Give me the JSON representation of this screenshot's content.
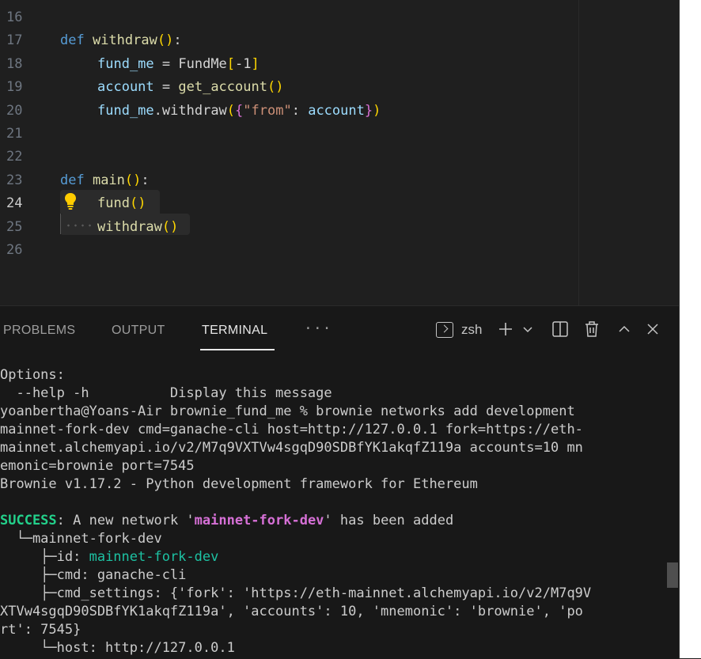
{
  "editor": {
    "lines": [
      {
        "n": "16",
        "tokens": []
      },
      {
        "n": "17",
        "tokens": [
          [
            "kw",
            "def "
          ],
          [
            "fn",
            "withdraw"
          ],
          [
            "pn1",
            "()"
          ],
          [
            "plain",
            ":"
          ]
        ]
      },
      {
        "n": "18",
        "indent": 1,
        "tokens": [
          [
            "var",
            "fund_me"
          ],
          [
            "plain",
            " = "
          ],
          [
            "plain",
            "FundMe"
          ],
          [
            "pn1",
            "["
          ],
          [
            "plain",
            "-1"
          ],
          [
            "pn1",
            "]"
          ]
        ]
      },
      {
        "n": "19",
        "indent": 1,
        "tokens": [
          [
            "var",
            "account"
          ],
          [
            "plain",
            " = "
          ],
          [
            "fn",
            "get_account"
          ],
          [
            "pn1",
            "()"
          ]
        ]
      },
      {
        "n": "20",
        "indent": 1,
        "tokens": [
          [
            "var",
            "fund_me"
          ],
          [
            "plain",
            "."
          ],
          [
            "plain",
            "withdraw"
          ],
          [
            "pn1",
            "("
          ],
          [
            "pn2",
            "{"
          ],
          [
            "str",
            "\"from\""
          ],
          [
            "plain",
            ": "
          ],
          [
            "var",
            "account"
          ],
          [
            "pn2",
            "}"
          ],
          [
            "pn1",
            ")"
          ]
        ]
      },
      {
        "n": "21",
        "tokens": []
      },
      {
        "n": "22",
        "tokens": []
      },
      {
        "n": "23",
        "tokens": [
          [
            "kw",
            "def "
          ],
          [
            "fn",
            "main"
          ],
          [
            "pn1",
            "()"
          ],
          [
            "plain",
            ":"
          ]
        ]
      },
      {
        "n": "24",
        "active": true,
        "indent": 1,
        "tokens": [
          [
            "fn",
            "fund"
          ],
          [
            "pn1",
            "()"
          ]
        ]
      },
      {
        "n": "25",
        "indent": 1,
        "tokens": [
          [
            "fn",
            "withdraw"
          ],
          [
            "pn1",
            "()"
          ]
        ]
      },
      {
        "n": "26",
        "tokens": []
      }
    ]
  },
  "panel": {
    "tabs": {
      "problems": "PROBLEMS",
      "output": "OUTPUT",
      "terminal": "TERMINAL",
      "more": "···"
    },
    "shell_name": "zsh"
  },
  "terminal": {
    "lines": [
      [
        [
          "",
          "Options:"
        ]
      ],
      [
        [
          "",
          "  --help -h          Display this message"
        ]
      ],
      [
        [
          "",
          "yoanbertha@Yoans-Air brownie_fund_me % brownie networks add development"
        ]
      ],
      [
        [
          "",
          "mainnet-fork-dev cmd=ganache-cli host=http://127.0.0.1 fork=https://eth-"
        ]
      ],
      [
        [
          "",
          "mainnet.alchemyapi.io/v2/M7q9VXTVw4sgqD90SDBfYK1akqfZ119a accounts=10 mn"
        ]
      ],
      [
        [
          "",
          "emonic=brownie port=7545"
        ]
      ],
      [
        [
          "",
          "Brownie v1.17.2 - Python development framework for Ethereum"
        ]
      ],
      [
        [
          "",
          ""
        ]
      ],
      [
        [
          "t-green",
          "SUCCESS"
        ],
        [
          "",
          ": A new network '"
        ],
        [
          "t-magenta",
          "mainnet-fork-dev"
        ],
        [
          "",
          "' has been added"
        ]
      ],
      [
        [
          "",
          "  └─mainnet-fork-dev"
        ]
      ],
      [
        [
          "",
          "     ├─id: "
        ],
        [
          "t-cyan",
          "mainnet-fork-dev"
        ]
      ],
      [
        [
          "",
          "     ├─cmd: ganache-cli"
        ]
      ],
      [
        [
          "",
          "     ├─cmd_settings: {'fork': 'https://eth-mainnet.alchemyapi.io/v2/M7q9V"
        ]
      ],
      [
        [
          "",
          "XTVw4sgqD90SDBfYK1akqfZ119a', 'accounts': 10, 'mnemonic': 'brownie', 'po"
        ]
      ],
      [
        [
          "",
          "rt': 7545}"
        ]
      ],
      [
        [
          "",
          "     └─host: http://127.0.0.1"
        ]
      ]
    ]
  },
  "colors": {
    "keyword": "#569cd6",
    "function": "#dcdcaa",
    "variable": "#9cdcfe",
    "string": "#ce9178",
    "bracket_gold": "#ffd700",
    "bracket_purple": "#da70d6",
    "success_green": "#23d18b",
    "network_magenta": "#d670d6",
    "id_cyan": "#1dc2a3"
  },
  "icons": [
    "lightbulb-icon",
    "terminal-icon",
    "plus-icon",
    "chevron-down-icon",
    "split-icon",
    "trash-icon",
    "chevron-up-icon",
    "close-icon"
  ]
}
